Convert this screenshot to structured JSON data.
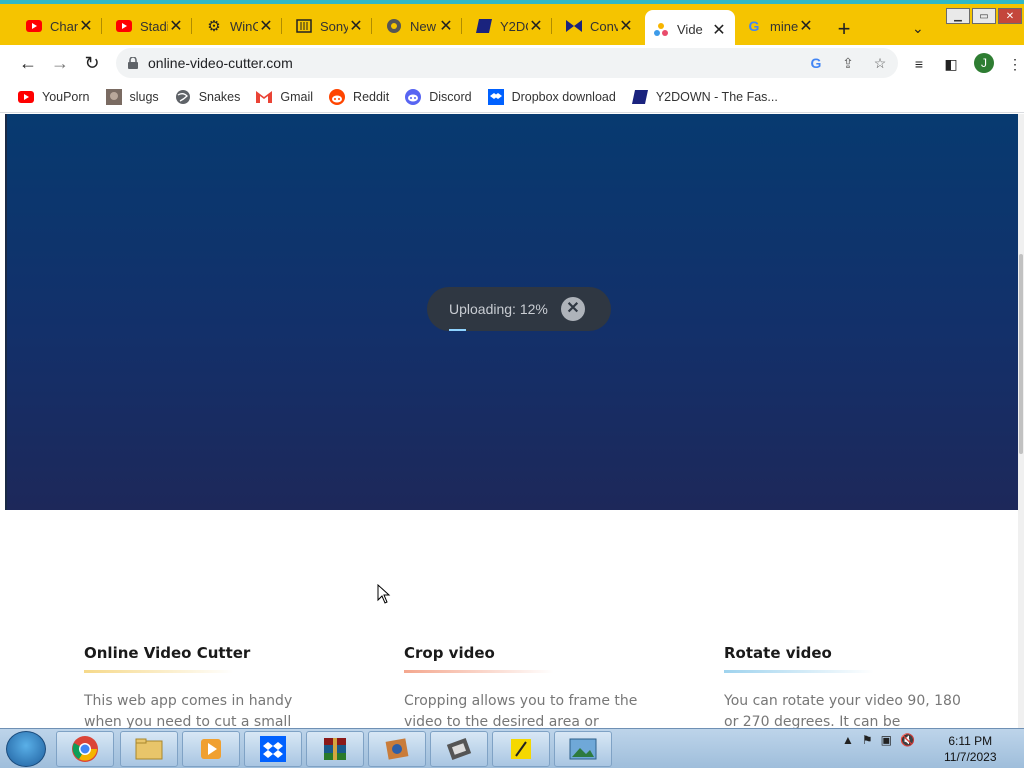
{
  "browser": {
    "tabs": [
      {
        "label": "Chan",
        "icon": "youtube-icon",
        "active": false
      },
      {
        "label": "Stadi",
        "icon": "youtube-icon",
        "active": false
      },
      {
        "label": "WinC",
        "icon": "gear-icon",
        "active": false
      },
      {
        "label": "Sony",
        "icon": "building-icon",
        "active": false
      },
      {
        "label": "New",
        "icon": "chrome-icon",
        "active": false
      },
      {
        "label": "Y2DO",
        "icon": "y2down-icon",
        "active": false
      },
      {
        "label": "Conv",
        "icon": "convert-icon",
        "active": false
      },
      {
        "label": "Vide",
        "icon": "video-cutter-icon",
        "active": true
      },
      {
        "label": "mine",
        "icon": "google-icon",
        "active": false
      }
    ],
    "url": "online-video-cutter.com",
    "profile_initial": "J",
    "bookmarks": [
      {
        "label": "YouPorn",
        "icon": "youtube-icon"
      },
      {
        "label": "slugs",
        "icon": "image-icon"
      },
      {
        "label": "Snakes",
        "icon": "globe-icon"
      },
      {
        "label": "Gmail",
        "icon": "gmail-icon"
      },
      {
        "label": "Reddit",
        "icon": "reddit-icon"
      },
      {
        "label": "Discord",
        "icon": "discord-icon"
      },
      {
        "label": "Dropbox download",
        "icon": "dropbox-icon"
      },
      {
        "label": "Y2DOWN - The Fas...",
        "icon": "y2down-icon"
      }
    ]
  },
  "upload": {
    "status": "Uploading: 12%",
    "progress": 0.12
  },
  "features": [
    {
      "title": "Online Video Cutter",
      "text": "This web app comes in handy when you need to cut a small",
      "accent": "#f6d98a"
    },
    {
      "title": "Crop video",
      "text": "Cropping allows you to frame the video to the desired area or",
      "accent": "#f4a78e"
    },
    {
      "title": "Rotate video",
      "text": "You can rotate your video 90, 180 or 270 degrees. It can be",
      "accent": "#9fd3ee"
    }
  ],
  "taskbar": {
    "time": "6:11 PM",
    "date": "11/7/2023"
  },
  "colors": {
    "tabstrip": "#f5c400",
    "hero_top": "#073a70",
    "hero_bottom": "#1d285a"
  }
}
